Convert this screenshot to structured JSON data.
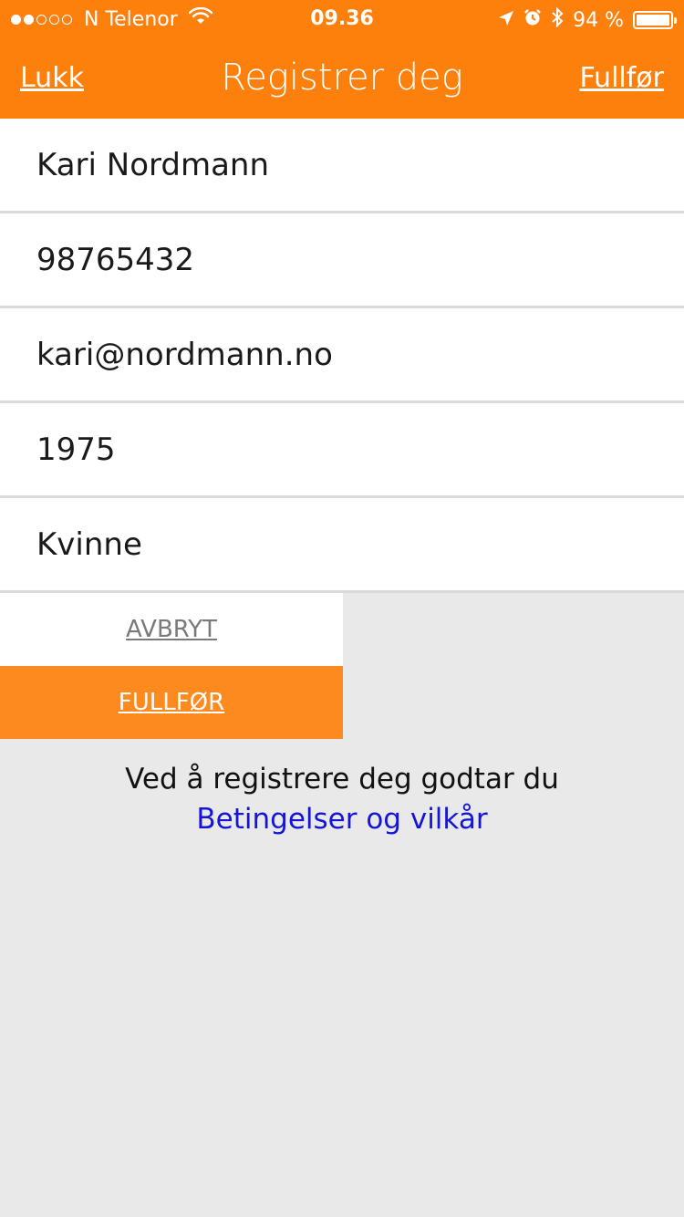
{
  "status_bar": {
    "signal_dots_full": 2,
    "signal_dots_total": 5,
    "carrier": "N Telenor",
    "time": "09.36",
    "battery": "94 %",
    "battery_level": 0.94,
    "icons": [
      "wifi-icon",
      "location-icon",
      "alarm-icon",
      "bluetooth-icon",
      "battery-icon"
    ]
  },
  "nav": {
    "left": "Lukk",
    "title": "Registrer deg",
    "right": "Fullfør"
  },
  "form": {
    "name": "Kari Nordmann",
    "phone": "98765432",
    "email": "kari@nordmann.no",
    "birth_year": "1975",
    "gender": "Kvinne"
  },
  "buttons": {
    "cancel": "AVBRYT",
    "finish": "FULLFØR"
  },
  "terms": {
    "text": "Ved å registrere deg godtar du",
    "link": "Betingelser og vilkår"
  },
  "colors": {
    "header": "#fd7f0c",
    "finish_button": "#fd8a1f",
    "link": "#1515d8",
    "background": "#e9e9e9"
  }
}
